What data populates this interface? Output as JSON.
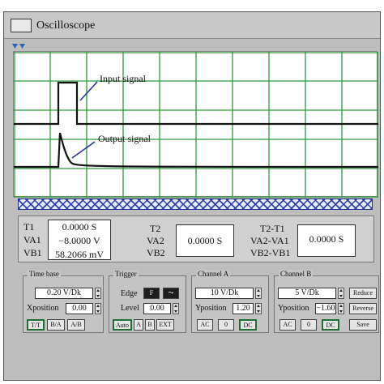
{
  "window": {
    "title": "Oscilloscope"
  },
  "screen": {
    "annotations": {
      "input": "Input signal",
      "output": "Output signal"
    },
    "colors": {
      "grid": "#2a9a3a",
      "trace": "#111111",
      "background": "#ffffff"
    },
    "grid_divisions": {
      "horizontal": 10,
      "vertical": 5
    }
  },
  "readouts": {
    "t1_label": "T1",
    "t1_value": "0.0000 S",
    "va1_label": "VA1",
    "va1_value": "−8.0000 V",
    "vb1_label": "VB1",
    "vb1_value": "58.2066 mV",
    "t2_label": "T2",
    "t2_value": "0.0000 S",
    "va2_label": "VA2",
    "vb2_label": "VB2",
    "dt_label": "T2-T1",
    "dt_value": "0.0000 S",
    "dva_label": "VA2-VA1",
    "dvb_label": "VB2-VB1"
  },
  "timebase": {
    "title": "Time base",
    "value": "0.20 V/Dk",
    "xposition_label": "Xposition",
    "xposition_value": "0.00",
    "buttons": [
      "T/T",
      "B/A",
      "A/B"
    ]
  },
  "trigger": {
    "title": "Trigger",
    "edge_label": "Edge",
    "edge_buttons": [
      "F",
      "⤳"
    ],
    "level_label": "Level",
    "level_value": "0.00",
    "buttons": [
      "Auto",
      "A",
      "B",
      "EXT"
    ]
  },
  "channel_a": {
    "title": "Channel A",
    "value": "10 V/Dk",
    "yposition_label": "Yposition",
    "yposition_value": "1.20",
    "buttons": [
      "AC",
      "0",
      "DC"
    ]
  },
  "channel_b": {
    "title": "Channel B",
    "value": "5 V/Dk",
    "yposition_label": "Yposition",
    "yposition_value": "−1.60",
    "buttons": [
      "AC",
      "0",
      "DC"
    ],
    "side_buttons": [
      "Reduce",
      "Reverse",
      "Save"
    ]
  }
}
